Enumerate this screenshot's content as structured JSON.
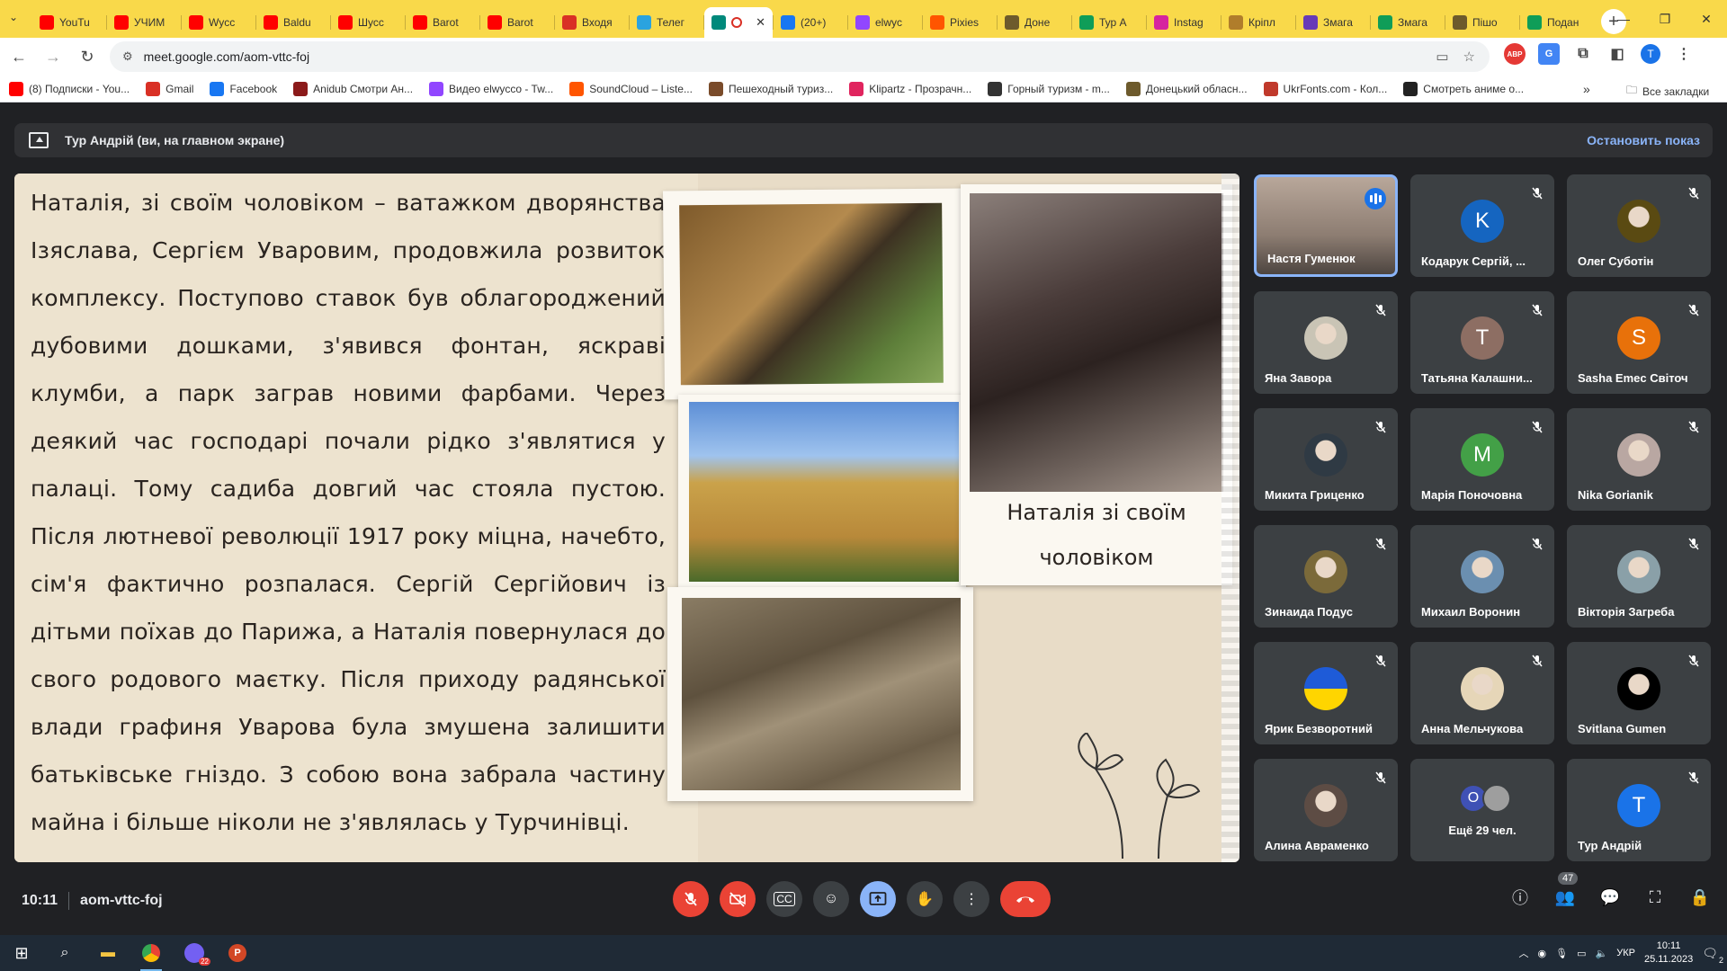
{
  "browser": {
    "tabs": [
      {
        "label": "YouTu",
        "icon": "youtube-icon",
        "color": "#ff0000"
      },
      {
        "label": "УЧИМ",
        "icon": "youtube-icon",
        "color": "#ff0000"
      },
      {
        "label": "Wycc",
        "icon": "youtube-icon",
        "color": "#ff0000"
      },
      {
        "label": "Baldu",
        "icon": "youtube-icon",
        "color": "#ff0000"
      },
      {
        "label": "Шусс",
        "icon": "youtube-icon",
        "color": "#ff0000"
      },
      {
        "label": "Barot",
        "icon": "youtube-icon",
        "color": "#ff0000"
      },
      {
        "label": "Barot",
        "icon": "youtube-icon",
        "color": "#ff0000"
      },
      {
        "label": "Входя",
        "icon": "gmail-icon",
        "color": "#d93025"
      },
      {
        "label": "Телег",
        "icon": "telegram-icon",
        "color": "#2aa3df"
      },
      {
        "label": "",
        "icon": "meet-icon",
        "color": "#00897b",
        "active": true
      },
      {
        "label": "(20+)",
        "icon": "facebook-icon",
        "color": "#1877f2"
      },
      {
        "label": "elwyc",
        "icon": "twitch-icon",
        "color": "#9146ff"
      },
      {
        "label": "Pixies",
        "icon": "soundcloud-icon",
        "color": "#ff5500"
      },
      {
        "label": "Доне",
        "icon": "site-icon",
        "color": "#6d5a2c"
      },
      {
        "label": "Тур А",
        "icon": "sheets-icon",
        "color": "#0f9d58"
      },
      {
        "label": "Instag",
        "icon": "instagram-icon",
        "color": "#d6249f"
      },
      {
        "label": "Кріпл",
        "icon": "site-icon",
        "color": "#b07d2b"
      },
      {
        "label": "Змага",
        "icon": "forms-icon",
        "color": "#673ab7"
      },
      {
        "label": "Змага",
        "icon": "sheets-icon",
        "color": "#0f9d58"
      },
      {
        "label": "Пішо",
        "icon": "site-icon",
        "color": "#6d5a2c"
      },
      {
        "label": "Подан",
        "icon": "sheets-icon",
        "color": "#0f9d58"
      }
    ],
    "url": "meet.google.com/aom-vttc-foj",
    "bookmarks": [
      {
        "label": "(8) Подписки - You...",
        "icon": "youtube-icon",
        "color": "#ff0000"
      },
      {
        "label": "Gmail",
        "icon": "gmail-icon",
        "color": "#d93025"
      },
      {
        "label": "Facebook",
        "icon": "facebook-icon",
        "color": "#1877f2"
      },
      {
        "label": "Anidub Смотри Ан...",
        "icon": "anidub-icon",
        "color": "#8b1a1a"
      },
      {
        "label": "Видео elwycco - Tw...",
        "icon": "twitch-icon",
        "color": "#9146ff"
      },
      {
        "label": "SoundCloud – Liste...",
        "icon": "soundcloud-icon",
        "color": "#ff5500"
      },
      {
        "label": "Пешеходный туриз...",
        "icon": "site-icon",
        "color": "#7a4b2a"
      },
      {
        "label": "Klipartz - Прозрачн...",
        "icon": "klipartz-icon",
        "color": "#e0245e"
      },
      {
        "label": "Горный туризм - m...",
        "icon": "mountain-icon",
        "color": "#333333"
      },
      {
        "label": "Донецький обласн...",
        "icon": "site-icon",
        "color": "#6d5a2c"
      },
      {
        "label": "UkrFonts.com - Кол...",
        "icon": "ukrfonts-icon",
        "color": "#c0392b"
      },
      {
        "label": "Смотреть аниме о...",
        "icon": "anime-icon",
        "color": "#222222"
      }
    ],
    "bookmarks_more": "»",
    "all_bookmarks": "Все закладки",
    "profile_initial": "T"
  },
  "meet": {
    "presenting_banner": "Тур Андрій (ви, на главном экране)",
    "stop_presenting": "Остановить показ",
    "slide": {
      "text": "Наталія, зі своїм чоловіком – ватажком дворянства Ізяслава, Сергієм Уваровим, продовжила розвиток комплексу. Поступово ставок був облагороджений дубовими дошками, з'явився фонтан, яскраві клумби, а парк заграв новими фарбами. Через деякий час господарі почали рідко з'являтися у палаці. Тому садиба довгий час стояла пустою. Після лютневої революції 1917 року міцна, начебто, сім'я фактично розпалася. Сергій Сергійович із дітьми поїхав до Парижа, а Наталія повернулася до свого родового маєтку. Після приходу радянської влади графиня Уварова була змушена залишити батьківське гніздо. З собою вона забрала частину майна і більше ніколи не з'являлась у Турчинівці.",
      "caption": "Наталія зі своїм чоловіком"
    },
    "participants": [
      {
        "name": "Настя Гуменюк",
        "avatar": "photo",
        "color": "#9a8676",
        "speaking": true
      },
      {
        "name": "Кодарук Сергій, ...",
        "avatar": "K",
        "color": "#1565c0"
      },
      {
        "name": "Олег Суботін",
        "avatar": "photo",
        "color": "#5a4a12"
      },
      {
        "name": "Яна Завора",
        "avatar": "photo",
        "color": "#c9c4b5"
      },
      {
        "name": "Татьяна Калашни...",
        "avatar": "T",
        "color": "#8d6e63"
      },
      {
        "name": "Sasha Emec Світоч",
        "avatar": "S",
        "color": "#e8710a"
      },
      {
        "name": "Микита Гриценко",
        "avatar": "photo",
        "color": "#2f3a44"
      },
      {
        "name": "Марія Поночовна",
        "avatar": "M",
        "color": "#43a047"
      },
      {
        "name": "Nika Gorianik",
        "avatar": "photo",
        "color": "#b9a7a2"
      },
      {
        "name": "Зинаида Подус",
        "avatar": "photo",
        "color": "#7b6a3a"
      },
      {
        "name": "Михаил Воронин",
        "avatar": "photo",
        "color": "#6b8fb0"
      },
      {
        "name": "Вікторія Загреба",
        "avatar": "photo",
        "color": "#8aa0a8"
      },
      {
        "name": "Ярик Безворотний",
        "avatar": "flag",
        "color": "#1e5bd8"
      },
      {
        "name": "Анна Мельчукова",
        "avatar": "photo",
        "color": "#e6d6b8"
      },
      {
        "name": "Svitlana Gumen",
        "avatar": "photo",
        "color": "#000000"
      },
      {
        "name": "Алина Авраменко",
        "avatar": "photo",
        "color": "#5d4c44"
      },
      {
        "name": "Ещё 29 чел.",
        "avatar": "more",
        "color": "#3f51b5",
        "more_initial": "O"
      },
      {
        "name": "Тур Андрій",
        "avatar": "T",
        "color": "#1a73e8"
      }
    ],
    "time": "10:11",
    "meeting_code": "aom-vttc-foj",
    "participant_count": "47"
  },
  "taskbar": {
    "language": "УКР",
    "time": "10:11",
    "date": "25.11.2023",
    "notifications": "2",
    "viber_badge": "22"
  },
  "colors": {
    "browser_theme": "#f9d94a",
    "meet_bg": "#202124",
    "danger": "#ea4335",
    "accent": "#8ab4f8"
  }
}
